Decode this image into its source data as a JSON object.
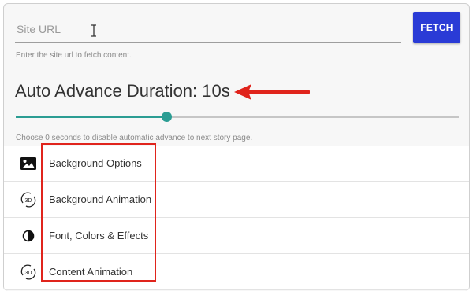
{
  "url_field": {
    "placeholder": "Site URL",
    "value": "",
    "helper": "Enter the site url to fetch content."
  },
  "fetch_button": {
    "label": "FETCH"
  },
  "auto_advance": {
    "title": "Auto Advance Duration: 10s",
    "value_seconds": 10,
    "slider_fraction": 0.34,
    "helper": "Choose 0 seconds to disable automatic advance to next story page."
  },
  "options": [
    {
      "label": "Background Options",
      "icon": "image-icon"
    },
    {
      "label": "Background Animation",
      "icon": "3d-rotation-icon"
    },
    {
      "label": "Font, Colors & Effects",
      "icon": "contrast-icon"
    },
    {
      "label": "Content Animation",
      "icon": "3d-rotation-icon"
    }
  ],
  "colors": {
    "accent": "#2a3bd6",
    "slider": "#2b9d93",
    "annotation": "#e0241c"
  }
}
